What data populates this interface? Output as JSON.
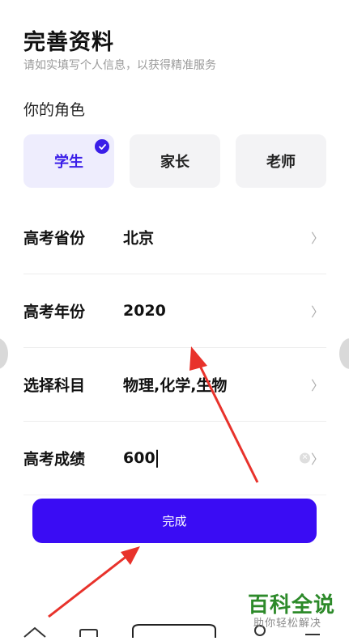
{
  "header": {
    "title": "完善资料",
    "subtitle": "请如实填写个人信息，以获得精准服务"
  },
  "roles": {
    "label": "你的角色",
    "options": [
      "学生",
      "家长",
      "老师"
    ],
    "selected": "学生"
  },
  "fields": [
    {
      "label": "高考省份",
      "value": "北京"
    },
    {
      "label": "高考年份",
      "value": "2020"
    },
    {
      "label": "选择科目",
      "value": "物理,化学,生物"
    },
    {
      "label": "高考成绩",
      "value": "600"
    }
  ],
  "submit_label": "完成",
  "watermark": {
    "brand": "百科全说",
    "tagline": "助你轻松解决"
  },
  "colors": {
    "accent": "#3a0cf4",
    "annotation_arrow": "#e8322b"
  },
  "icons": [
    "check-icon",
    "chevron-right-icon",
    "clear-icon",
    "home-icon",
    "square-icon",
    "person-icon",
    "menu-icon"
  ]
}
